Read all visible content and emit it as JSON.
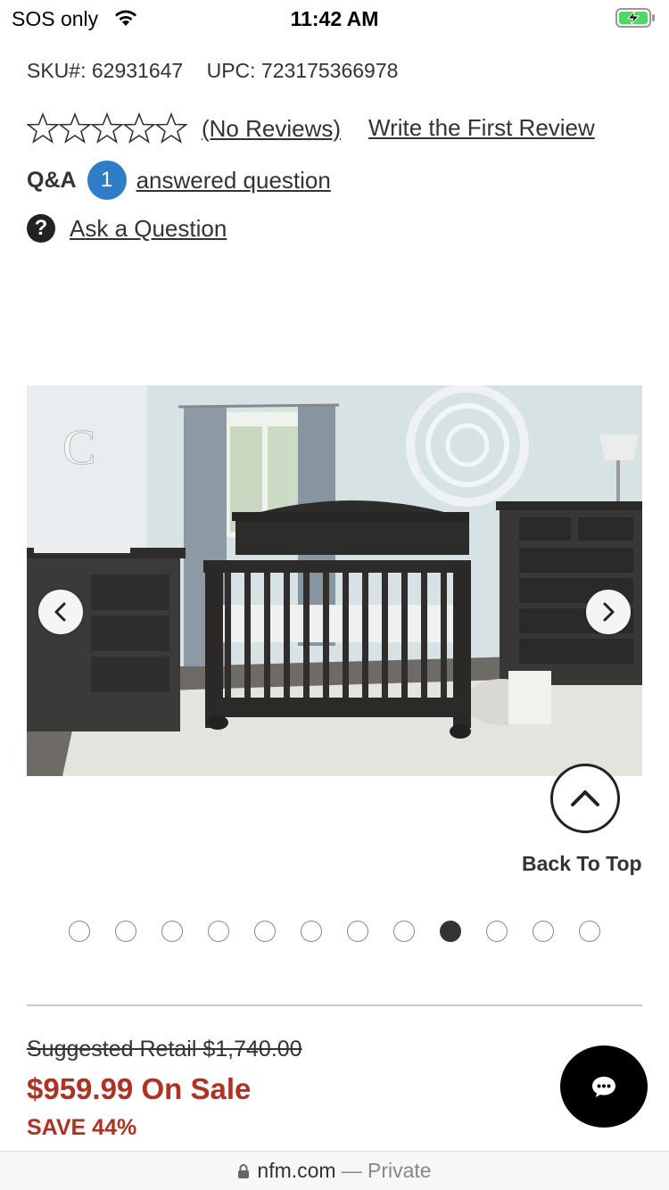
{
  "status": {
    "carrier": "SOS only",
    "time": "11:42 AM"
  },
  "product": {
    "sku_label": "SKU#: 62931647",
    "upc_label": "UPC: 723175366978"
  },
  "reviews": {
    "rating": 0,
    "max_rating": 5,
    "count_label": "(No Reviews)",
    "write_label": "Write the First Review"
  },
  "qa": {
    "label": "Q&A",
    "count": "1",
    "link": "answered question",
    "ask_label": "Ask a Question"
  },
  "gallery": {
    "active_index": 8,
    "total_images": 12
  },
  "back_to_top": "Back To Top",
  "pricing": {
    "retail": "Suggested Retail $1,740.00",
    "sale": "$959.99 On Sale",
    "save": "SAVE 44%",
    "sale_color": "#b03021"
  },
  "browser": {
    "host": "nfm.com",
    "mode": "— Private"
  },
  "icons": {
    "qa_badge_color": "#2f7dc8"
  }
}
